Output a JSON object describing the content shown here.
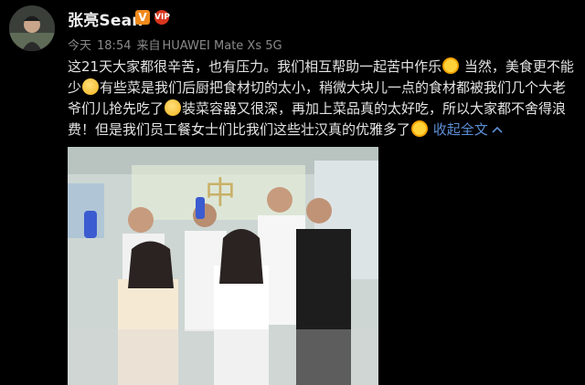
{
  "user": {
    "name": "张亮Sean",
    "verified_badge": "V",
    "vip_badge": "VIP"
  },
  "meta": {
    "date": "今天",
    "time": "18:54",
    "source_prefix": "来自",
    "device": "HUAWEI Mate Xs 5G"
  },
  "post": {
    "text_1": "这21天大家都很辛苦，也有压力。我们相互帮助一起苦中作乐",
    "text_2": "当然，美食更不能少",
    "text_3": "有些菜是我们后厨把食材切的太小，稍微大块儿一点的食材都被我们几个大老爷们儿抢先吃了",
    "text_4": "装菜容器又很深，再加上菜品真的太好吃，所以大家都不舍得浪费！但是我们员工餐女士们比我们这些壮汉真的优雅多了",
    "expand_label": "收起全文",
    "expand_icon": "chevron-up-icon"
  },
  "photo": {
    "wall_sign": "中"
  },
  "colors": {
    "background": "#000000",
    "link": "#5b8fd6",
    "meta": "#8a8a8a",
    "text": "#e4e4e4"
  }
}
